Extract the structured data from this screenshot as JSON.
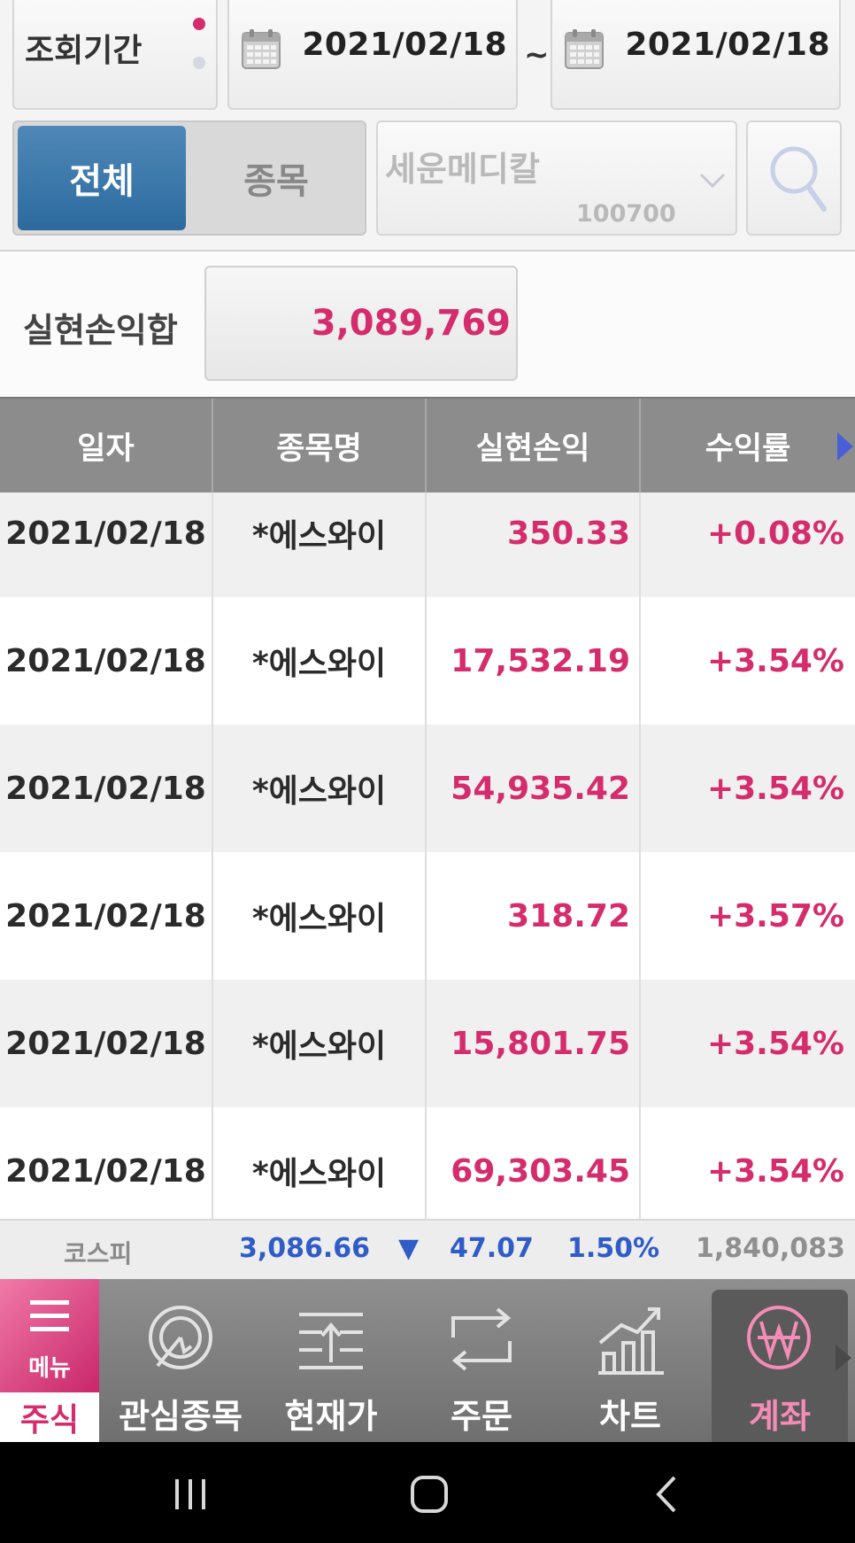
{
  "filter": {
    "period_label": "조회기간",
    "date_from": "2021/02/18",
    "date_separator": "~",
    "date_to": "2021/02/18",
    "segment_all": "전체",
    "segment_stock": "종목",
    "stock_name": "세운메디칼",
    "stock_code": "100700"
  },
  "summary": {
    "label": "실현손익합",
    "value": "3,089,769"
  },
  "table": {
    "headers": [
      "일자",
      "종목명",
      "실현손익",
      "수익률"
    ],
    "rows": [
      {
        "date": "2021/02/18",
        "name": "*에스와이",
        "pl": "350.33",
        "rate": "+0.08%"
      },
      {
        "date": "2021/02/18",
        "name": "*에스와이",
        "pl": "17,532.19",
        "rate": "+3.54%"
      },
      {
        "date": "2021/02/18",
        "name": "*에스와이",
        "pl": "54,935.42",
        "rate": "+3.54%"
      },
      {
        "date": "2021/02/18",
        "name": "*에스와이",
        "pl": "318.72",
        "rate": "+3.57%"
      },
      {
        "date": "2021/02/18",
        "name": "*에스와이",
        "pl": "15,801.75",
        "rate": "+3.54%"
      },
      {
        "date": "2021/02/18",
        "name": "*에스와이",
        "pl": "69,303.45",
        "rate": "+3.54%"
      }
    ]
  },
  "ticker": {
    "name": "코스피",
    "index": "3,086.66",
    "direction_symbol": "▼",
    "change": "47.07",
    "change_pct": "1.50%",
    "volume": "1,840,083"
  },
  "menu": {
    "menu_label": "메뉴",
    "current_section": "주식",
    "items": [
      {
        "label": "관심종목",
        "icon": "watchlist-icon"
      },
      {
        "label": "현재가",
        "icon": "current-price-icon"
      },
      {
        "label": "주문",
        "icon": "order-icon"
      },
      {
        "label": "차트",
        "icon": "chart-icon"
      },
      {
        "label": "계좌",
        "icon": "won-account-icon",
        "active": true
      }
    ]
  },
  "colors": {
    "accent_pink": "#d42c6c",
    "selected_blue": "#2c6a9e",
    "ticker_blue": "#2f5cc7",
    "header_gray": "#8c8c8c"
  }
}
